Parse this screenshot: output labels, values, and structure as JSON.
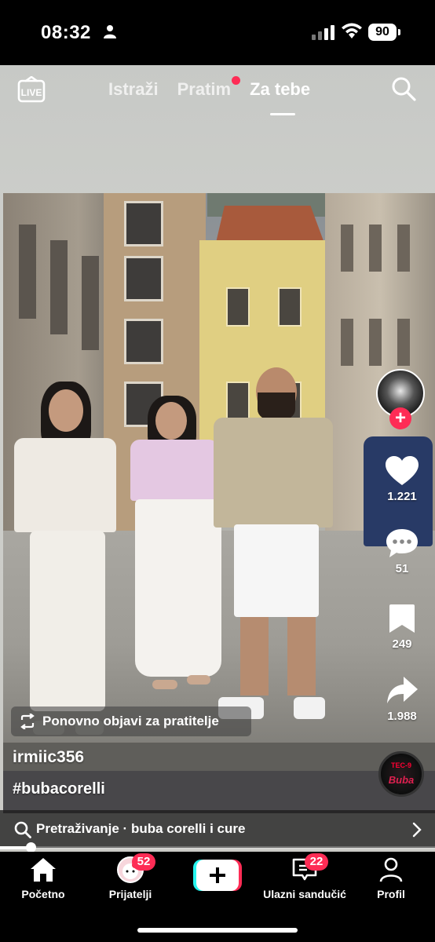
{
  "status_bar": {
    "time": "08:32",
    "battery": "90"
  },
  "top_nav": {
    "live_icon": "live-icon",
    "tabs": [
      {
        "label": "Istraži",
        "active": false
      },
      {
        "label": "Pratim",
        "active": false,
        "has_dot": true
      },
      {
        "label": "Za tebe",
        "active": true
      }
    ],
    "search_icon": "search-icon"
  },
  "actions": {
    "likes": "1.221",
    "comments": "51",
    "saves": "249",
    "shares": "1.988"
  },
  "post": {
    "repost_label": "Ponovno objavi za pratitelje",
    "username": "irmiic356",
    "caption": "#bubacorelli",
    "music_disc_text": "TEC-9",
    "music_disc_sub": "Buba"
  },
  "search_suggestion": {
    "text": "Pretraživanje · buba corelli i cure"
  },
  "video_progress": 0.07,
  "bottom_nav": {
    "items": [
      {
        "label": "Početno",
        "icon": "home-icon"
      },
      {
        "label": "Prijatelji",
        "icon": "friends-avatar",
        "badge": "52"
      },
      {
        "label": "",
        "icon": "create-plus-icon"
      },
      {
        "label": "Ulazni sandučić",
        "icon": "inbox-icon",
        "badge": "22"
      },
      {
        "label": "Profil",
        "icon": "profile-icon"
      }
    ]
  },
  "colors": {
    "accent": "#fe2c55",
    "cyan": "#25f4ee",
    "nav_bg": "#000000"
  }
}
